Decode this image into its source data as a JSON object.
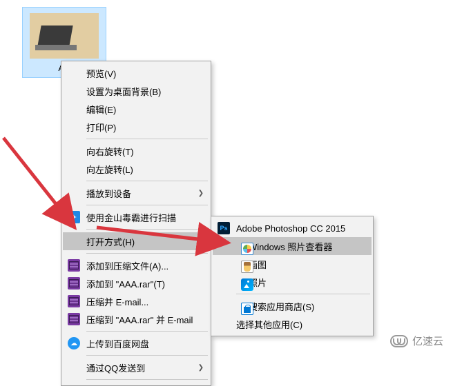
{
  "file": {
    "name_visible": "AA"
  },
  "menu": {
    "preview": "预览(V)",
    "set_wallpaper": "设置为桌面背景(B)",
    "edit": "编辑(E)",
    "print": "打印(P)",
    "rotate_right": "向右旋转(T)",
    "rotate_left": "向左旋转(L)",
    "cast_to_device": "播放到设备",
    "kingsoft_scan": "使用金山毒霸进行扫描",
    "open_with": "打开方式(H)",
    "add_to_archive": "添加到压缩文件(A)...",
    "add_to_rar": "添加到 \"AAA.rar\"(T)",
    "compress_email": "压缩并 E-mail...",
    "compress_rar_email": "压缩到 \"AAA.rar\" 并 E-mail",
    "upload_baidu": "上传到百度网盘",
    "send_via_qq": "通过QQ发送到"
  },
  "submenu": {
    "photoshop": "Adobe Photoshop CC 2015",
    "windows_photo_viewer": "Windows 照片查看器",
    "paint": "画图",
    "photos": "照片",
    "search_store": "搜索应用商店(S)",
    "choose_other": "选择其他应用(C)"
  },
  "watermark": {
    "text": "亿速云"
  },
  "colors": {
    "arrow": "#d9363e"
  }
}
